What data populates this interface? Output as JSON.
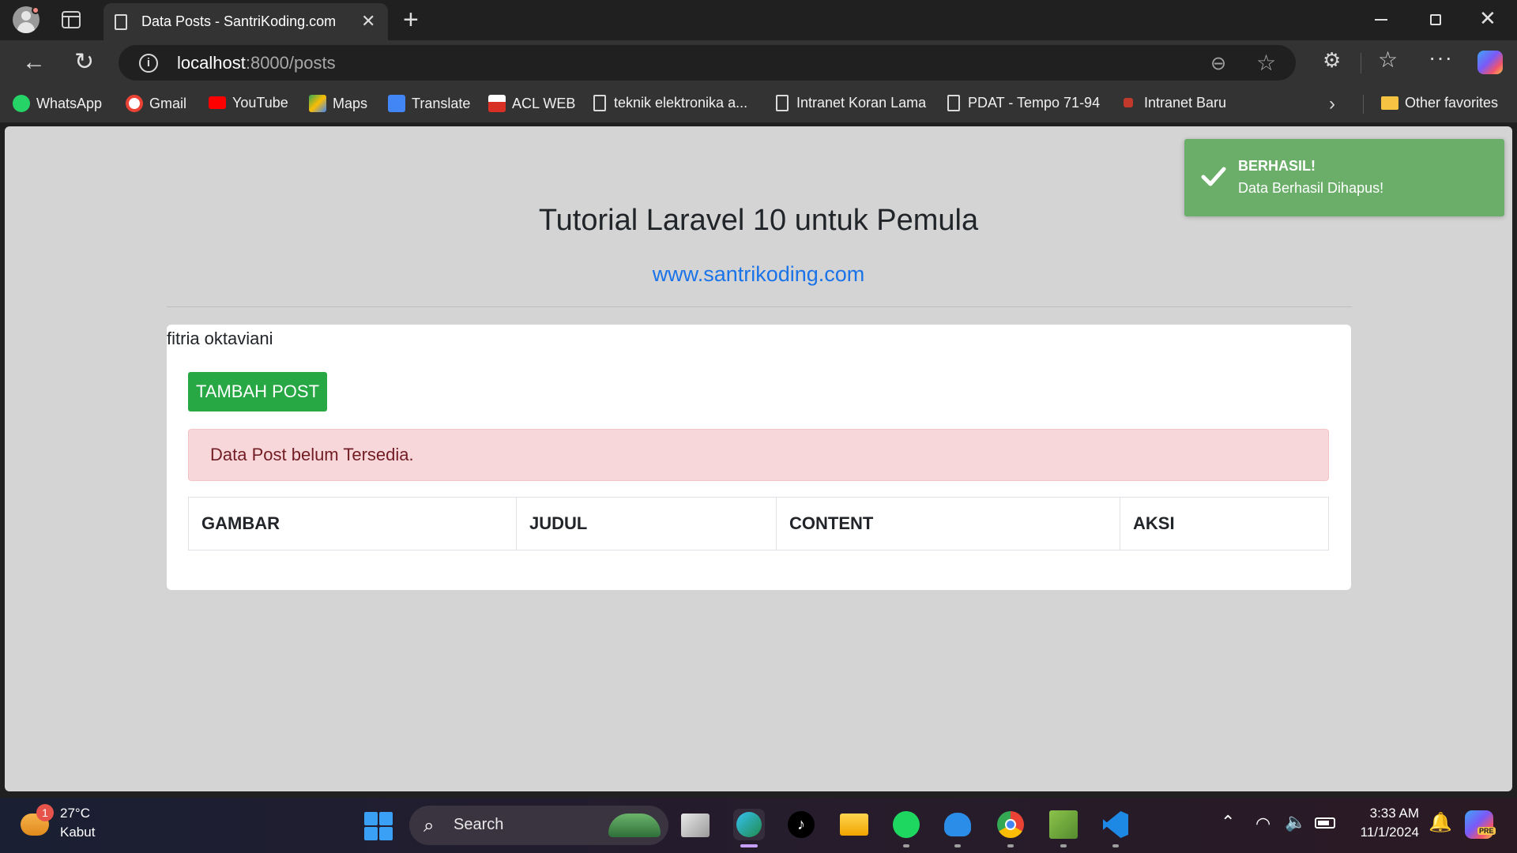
{
  "browser": {
    "tab_title": "Data Posts - SantriKoding.com",
    "tab_close": "✕",
    "new_tab": "+",
    "url_host": "localhost",
    "url_path": ":8000/posts",
    "bookmarks": [
      {
        "label": "WhatsApp",
        "icon": "whatsapp-icon",
        "color": "#25d366"
      },
      {
        "label": "Gmail",
        "icon": "google-icon",
        "color": "#ffffff"
      },
      {
        "label": "YouTube",
        "icon": "youtube-icon",
        "color": "#ff0000"
      },
      {
        "label": "Maps",
        "icon": "maps-icon",
        "color": "#34a853"
      },
      {
        "label": "Translate",
        "icon": "translate-icon",
        "color": "#4285f4"
      },
      {
        "label": "ACL WEB",
        "icon": "acl-icon",
        "color": "#d93025"
      },
      {
        "label": "teknik elektronika a...",
        "icon": "file-icon"
      },
      {
        "label": "Intranet Koran Lama",
        "icon": "file-icon"
      },
      {
        "label": "PDAT - Tempo 71-94",
        "icon": "file-icon"
      },
      {
        "label": "Intranet Baru",
        "icon": "intranet-icon",
        "color": "#c0392b"
      }
    ],
    "other_favorites": "Other favorites"
  },
  "page": {
    "heading": "Tutorial Laravel 10 untuk Pemula",
    "site_link": "www.santrikoding.com",
    "username": "fitria oktaviani",
    "add_button": "TAMBAH POST",
    "empty_alert": "Data Post belum Tersedia.",
    "table_headers": [
      "GAMBAR",
      "JUDUL",
      "CONTENT",
      "AKSI"
    ]
  },
  "toast": {
    "title": "BERHASIL!",
    "message": "Data Berhasil Dihapus!",
    "color": "#6aae6a"
  },
  "taskbar": {
    "weather_badge": "1",
    "temperature": "27°C",
    "condition": "Kabut",
    "search_label": "Search",
    "time": "3:33 AM",
    "date": "11/1/2024",
    "copilot_badge": "PRE"
  },
  "colors": {
    "accent_green": "#28a745",
    "link_blue": "#1a73e8",
    "alert_bg": "#f8d7da"
  }
}
